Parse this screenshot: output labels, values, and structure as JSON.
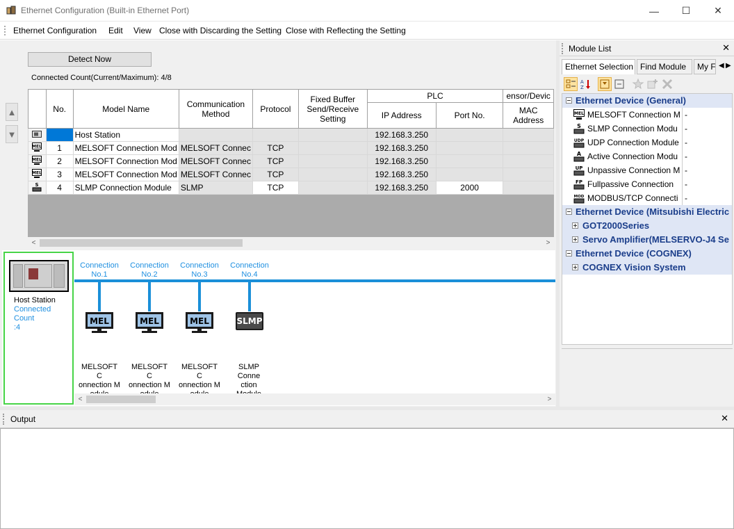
{
  "window": {
    "title": "Ethernet Configuration (Built-in Ethernet Port)",
    "minimize": "—",
    "maximize": "☐",
    "close": "✕"
  },
  "menu": {
    "items": [
      "Ethernet Configuration",
      "Edit",
      "View",
      "Close with Discarding the Setting",
      "Close with Reflecting the Setting"
    ]
  },
  "main": {
    "detect_button": "Detect Now",
    "connected_count": "Connected Count(Current/Maximum):  4/8",
    "headers": {
      "no": "No.",
      "model_name": "Model Name",
      "comm_method": "Communication Method",
      "protocol": "Protocol",
      "fixed_buffer": "Fixed Buffer Send/Receive Setting",
      "plc": "PLC",
      "ip_address": "IP Address",
      "port_no": "Port No.",
      "sensor_device": "ensor/Devic",
      "mac_address": "MAC Address"
    },
    "rows": [
      {
        "icon": "host",
        "no": "",
        "model": "Host Station",
        "method": "",
        "protocol": "",
        "ip": "192.168.3.250",
        "port": ""
      },
      {
        "icon": "mel",
        "no": "1",
        "model": "MELSOFT Connection Mod",
        "method": "MELSOFT Connec",
        "protocol": "TCP",
        "ip": "192.168.3.250",
        "port": ""
      },
      {
        "icon": "mel",
        "no": "2",
        "model": "MELSOFT Connection Mod",
        "method": "MELSOFT Connec",
        "protocol": "TCP",
        "ip": "192.168.3.250",
        "port": ""
      },
      {
        "icon": "mel",
        "no": "3",
        "model": "MELSOFT Connection Mod",
        "method": "MELSOFT Connec",
        "protocol": "TCP",
        "ip": "192.168.3.250",
        "port": ""
      },
      {
        "icon": "slmp",
        "no": "4",
        "model": "SLMP Connection Module",
        "method": "SLMP",
        "protocol": "TCP",
        "ip": "192.168.3.250",
        "port": "2000"
      }
    ]
  },
  "diagram": {
    "host_label": "Host Station",
    "host_count": "Connected Count",
    "host_count_value": ":4",
    "connections": [
      {
        "line1": "Connection",
        "line2": "No.1",
        "device": "MEL",
        "label1": "MELSOFT C",
        "label2": "onnection M",
        "label3": "odule"
      },
      {
        "line1": "Connection",
        "line2": "No.2",
        "device": "MEL",
        "label1": "MELSOFT C",
        "label2": "onnection M",
        "label3": "odule"
      },
      {
        "line1": "Connection",
        "line2": "No.3",
        "device": "MEL",
        "label1": "MELSOFT C",
        "label2": "onnection M",
        "label3": "odule"
      },
      {
        "line1": "Connection",
        "line2": "No.4",
        "device": "SLMP",
        "label1": "SLMP Conne",
        "label2": "ction Module",
        "label3": ""
      }
    ]
  },
  "module_list": {
    "title": "Module List",
    "close": "✕",
    "tabs": [
      "Ethernet Selection",
      "Find Module",
      "My F"
    ],
    "categories": {
      "general": "Ethernet Device (General)",
      "mitsubishi": "Ethernet Device (Mitsubishi Electric",
      "cognex": "Ethernet Device (COGNEX)"
    },
    "modules": [
      {
        "icon": "mel",
        "name": "MELSOFT Connection M",
        "desc": "-"
      },
      {
        "icon": "slmp",
        "name": "SLMP Connection Modu",
        "desc": "-"
      },
      {
        "icon": "udp",
        "name": "UDP Connection Module",
        "desc": "-"
      },
      {
        "icon": "active",
        "name": "Active Connection Modu",
        "desc": "-"
      },
      {
        "icon": "unpassive",
        "name": "Unpassive Connection M",
        "desc": "-"
      },
      {
        "icon": "fullpassive",
        "name": "Fullpassive Connection",
        "desc": "-"
      },
      {
        "icon": "modbus",
        "name": "MODBUS/TCP Connecti",
        "desc": "-"
      }
    ],
    "subgroups": {
      "got": "GOT2000Series",
      "servo": "Servo Amplifier(MELSERVO-J4 Se",
      "cognex_vision": "COGNEX Vision System"
    }
  },
  "output": {
    "title": "Output",
    "close": "✕"
  },
  "colors": {
    "bus": "#1a8fd8",
    "selection": "#0078d7",
    "host_border": "#46d446",
    "category_text": "#1a3d8a"
  }
}
